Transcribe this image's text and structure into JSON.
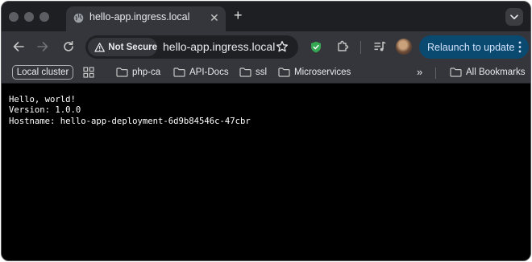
{
  "tab": {
    "title": "hello-app.ingress.local",
    "favicon": "globe-icon"
  },
  "toolbar": {
    "security_label": "Not Secure",
    "url": "hello-app.ingress.local",
    "relaunch_label": "Relaunch to update",
    "accent": "#0b4a70"
  },
  "bookmarks": {
    "chip": "Local cluster",
    "folders": [
      "php-ca",
      "API-Docs",
      "ssl",
      "Microservices"
    ],
    "overflow": "»",
    "all_label": "All Bookmarks"
  },
  "page": {
    "lines": [
      "Hello, world!",
      "Version: 1.0.0",
      "Hostname: hello-app-deployment-6d9b84546c-47cbr"
    ]
  }
}
